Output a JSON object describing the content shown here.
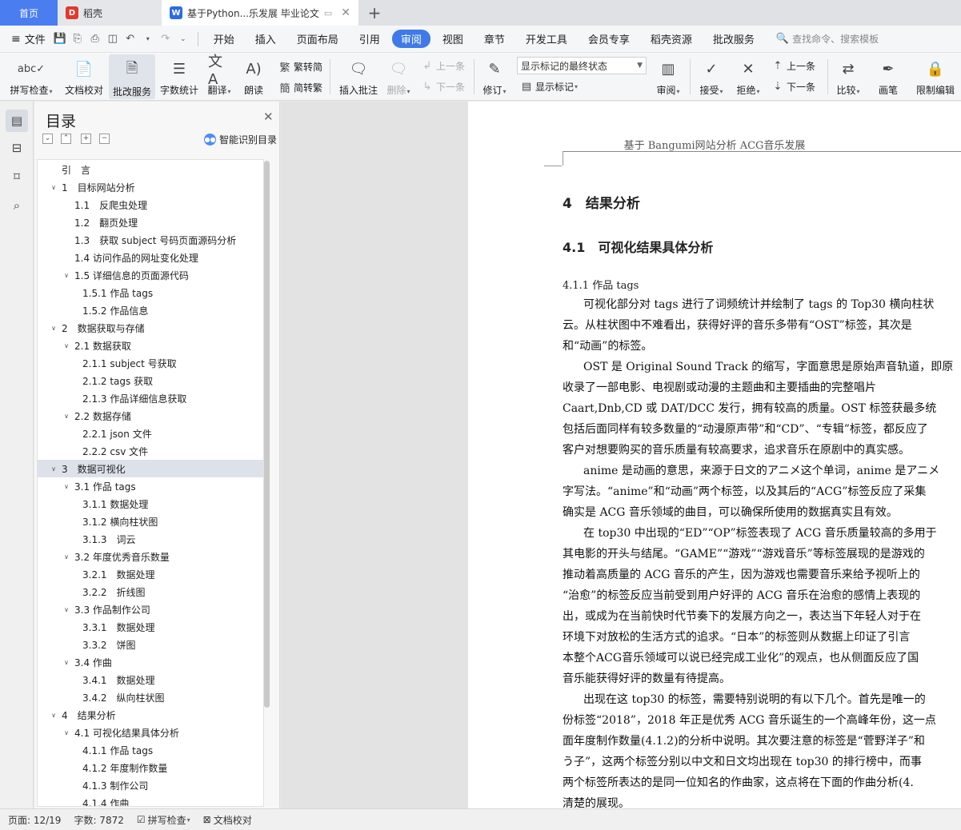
{
  "tabs": {
    "home": "首页",
    "daoke": "稻壳",
    "doc": "基于Python...乐发展 毕业论文"
  },
  "menu": {
    "file": "文件",
    "tabs": [
      "开始",
      "插入",
      "页面布局",
      "引用",
      "审阅",
      "视图",
      "章节",
      "开发工具",
      "会员专享",
      "稻壳资源",
      "批改服务"
    ],
    "active_index": 4,
    "search": "查找命令、搜索模板"
  },
  "ribbon": {
    "spell_check": "拼写检查",
    "doc_proof": "文档校对",
    "correction_service": "批改服务",
    "word_count": "字数统计",
    "translate": "翻译",
    "read_aloud": "朗读",
    "trad_to_simp": "繁转简",
    "simp_to_trad": "简转繁",
    "insert_comment": "插入批注",
    "delete": "删除",
    "prev_comment": "上一条",
    "next_comment": "下一条",
    "revise": "修订",
    "markup_mode": "显示标记的最终状态",
    "show_markup": "显示标记",
    "review": "审阅",
    "accept": "接受",
    "reject": "拒绝",
    "prev_change": "上一条",
    "next_change": "下一条",
    "compare": "比较",
    "pen": "画笔",
    "restrict_edit": "限制编辑"
  },
  "toc": {
    "title": "目录",
    "smart_toc": "智能识别目录",
    "items": [
      {
        "text": "引　言",
        "level": 0,
        "toggle": ""
      },
      {
        "text": "1　目标网站分析",
        "level": 0,
        "toggle": "v"
      },
      {
        "text": "1.1　反爬虫处理",
        "level": 1,
        "toggle": ""
      },
      {
        "text": "1.2　翻页处理",
        "level": 1,
        "toggle": ""
      },
      {
        "text": "1.3　获取 subject 号码页面源码分析",
        "level": 1,
        "toggle": ""
      },
      {
        "text": "1.4 访问作品的网址变化处理",
        "level": 1,
        "toggle": ""
      },
      {
        "text": "1.5 详细信息的页面源代码",
        "level": 1,
        "toggle": "v"
      },
      {
        "text": "1.5.1 作品 tags",
        "level": 2,
        "toggle": ""
      },
      {
        "text": "1.5.2 作品信息",
        "level": 2,
        "toggle": ""
      },
      {
        "text": "2　数据获取与存储",
        "level": 0,
        "toggle": "v"
      },
      {
        "text": "2.1 数据获取",
        "level": 1,
        "toggle": "v"
      },
      {
        "text": "2.1.1 subject 号获取",
        "level": 2,
        "toggle": ""
      },
      {
        "text": "2.1.2 tags 获取",
        "level": 2,
        "toggle": ""
      },
      {
        "text": "2.1.3 作品详细信息获取",
        "level": 2,
        "toggle": ""
      },
      {
        "text": "2.2 数据存储",
        "level": 1,
        "toggle": "v"
      },
      {
        "text": "2.2.1 json 文件",
        "level": 2,
        "toggle": ""
      },
      {
        "text": "2.2.2 csv 文件",
        "level": 2,
        "toggle": ""
      },
      {
        "text": "3　数据可视化",
        "level": 0,
        "toggle": "v",
        "selected": true
      },
      {
        "text": "3.1 作品 tags",
        "level": 1,
        "toggle": "v"
      },
      {
        "text": "3.1.1 数据处理",
        "level": 2,
        "toggle": ""
      },
      {
        "text": "3.1.2 横向柱状图",
        "level": 2,
        "toggle": ""
      },
      {
        "text": "3.1.3　词云",
        "level": 2,
        "toggle": ""
      },
      {
        "text": "3.2 年度优秀音乐数量",
        "level": 1,
        "toggle": "v"
      },
      {
        "text": "3.2.1　数据处理",
        "level": 2,
        "toggle": ""
      },
      {
        "text": "3.2.2　折线图",
        "level": 2,
        "toggle": ""
      },
      {
        "text": "3.3 作品制作公司",
        "level": 1,
        "toggle": "v"
      },
      {
        "text": "3.3.1　数据处理",
        "level": 2,
        "toggle": ""
      },
      {
        "text": "3.3.2　饼图",
        "level": 2,
        "toggle": ""
      },
      {
        "text": "3.4 作曲",
        "level": 1,
        "toggle": "v"
      },
      {
        "text": "3.4.1　数据处理",
        "level": 2,
        "toggle": ""
      },
      {
        "text": "3.4.2　纵向柱状图",
        "level": 2,
        "toggle": ""
      },
      {
        "text": "4　结果分析",
        "level": 0,
        "toggle": "v"
      },
      {
        "text": "4.1 可视化结果具体分析",
        "level": 1,
        "toggle": "v"
      },
      {
        "text": "4.1.1 作品 tags",
        "level": 2,
        "toggle": ""
      },
      {
        "text": "4.1.2 年度制作数量",
        "level": 2,
        "toggle": ""
      },
      {
        "text": "4.1.3 制作公司",
        "level": 2,
        "toggle": ""
      },
      {
        "text": "4.1.4 作曲",
        "level": 2,
        "toggle": ""
      }
    ]
  },
  "document": {
    "header": "基于 Bangumi网站分析 ACG音乐发展",
    "h1": "4　结果分析",
    "h2": "4.1　可视化结果具体分析",
    "h3": "4.1.1 作品 tags",
    "lines": [
      {
        "text": "可视化部分对 tags 进行了词频统计并绘制了 tags 的 Top30 横向柱状",
        "indent": true
      },
      {
        "text": "云。从柱状图中不难看出，获得好评的音乐多带有“OST”标签，其次是",
        "indent": false
      },
      {
        "text": "和“动画”的标签。",
        "indent": false
      },
      {
        "text": "OST 是 Original Sound Track 的缩写，字面意思是原始声音轨道，即原",
        "indent": true
      },
      {
        "text": "收录了一部电影、电视剧或动漫的主题曲和主要插曲的完整唱片",
        "indent": false
      },
      {
        "text": "Caart,Dnb,CD 或 DAT/DCC 发行，拥有较高的质量。OST 标签获最多统",
        "indent": false
      },
      {
        "text": "包括后面同样有较多数量的“动漫原声带”和“CD”、“专辑”标签，都反应了",
        "indent": false
      },
      {
        "text": "客户对想要购买的音乐质量有较高要求，追求音乐在原剧中的真实感。",
        "indent": false
      },
      {
        "text": "anime 是动画的意思，来源于日文的アニメ这个单词，anime 是アニメ",
        "indent": true
      },
      {
        "text": "字写法。“anime”和“动画”两个标签，以及其后的“ACG”标签反应了采集",
        "indent": false
      },
      {
        "text": "确实是 ACG 音乐领域的曲目，可以确保所使用的数据真实且有效。",
        "indent": false
      },
      {
        "text": "在 top30 中出现的“ED”“OP”标签表现了 ACG 音乐质量较高的多用于",
        "indent": true
      },
      {
        "text": "其电影的开头与结尾。“GAME”“游戏”“游戏音乐”等标签展现的是游戏的",
        "indent": false
      },
      {
        "text": "推动着高质量的 ACG 音乐的产生，因为游戏也需要音乐来给予视听上的",
        "indent": false
      },
      {
        "text": "“治愈”的标签反应当前受到用户好评的 ACG 音乐在治愈的感情上表现的",
        "indent": false
      },
      {
        "text": "出，或成为在当前快时代节奏下的发展方向之一，表达当下年轻人对于在",
        "indent": false
      },
      {
        "text": "环境下对放松的生活方式的追求。“日本”的标签则从数据上印证了引言",
        "indent": false
      },
      {
        "text": "本整个ACG音乐领域可以说已经完成工业化”的观点，也从侧面反应了国",
        "indent": false
      },
      {
        "text": "音乐能获得好评的数量有待提高。",
        "indent": false
      },
      {
        "text": "出现在这 top30 的标签，需要特别说明的有以下几个。首先是唯一的",
        "indent": true
      },
      {
        "text": "份标签“2018”，2018 年正是优秀 ACG 音乐诞生的一个高峰年份，这一点",
        "indent": false
      },
      {
        "text": "面年度制作数量(4.1.2)的分析中说明。其次要注意的标签是“菅野洋子”和",
        "indent": false
      },
      {
        "text": "う子”，这两个标签分别以中文和日文均出现在 top30 的排行榜中，而事",
        "indent": false
      },
      {
        "text": "两个标签所表达的是同一位知名的作曲家，这点将在下面的作曲分析(4.",
        "indent": false
      },
      {
        "text": "清楚的展现。",
        "indent": false
      }
    ]
  },
  "status": {
    "page": "页面: 12/19",
    "words": "字数: 7872",
    "spell": "拼写检查",
    "proof": "文档校对"
  }
}
